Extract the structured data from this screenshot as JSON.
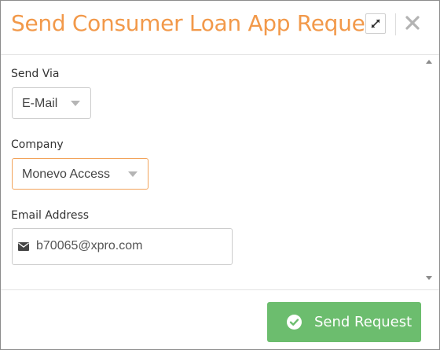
{
  "dialog": {
    "title": "Send Consumer Loan App Request",
    "expand_icon": "expand-arrows-icon",
    "close_icon": "close-x-icon"
  },
  "form": {
    "send_via": {
      "label": "Send Via",
      "value": "E-Mail"
    },
    "company": {
      "label": "Company",
      "value": "Monevo Access"
    },
    "email": {
      "label": "Email Address",
      "value": "b70065@xpro.com",
      "icon": "envelope-icon"
    }
  },
  "footer": {
    "send_label": "Send Request",
    "send_icon": "check-circle-icon"
  },
  "colors": {
    "title": "#f2994a",
    "primary_button": "#6cbd6e",
    "focus_border": "#f2a35a"
  }
}
